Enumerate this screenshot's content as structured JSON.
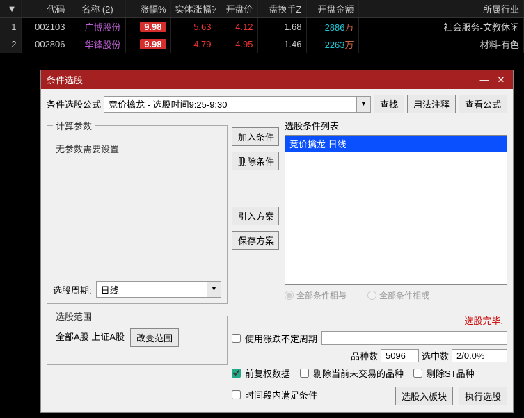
{
  "table": {
    "headers": [
      "代码",
      "名称 (2)",
      "涨幅%",
      "实体涨幅%",
      "开盘价",
      "盘换手Z",
      "开盘金额",
      "所属行业"
    ],
    "rows": [
      {
        "idx": "1",
        "code": "002103",
        "name": "广博股份",
        "pct": "9.98",
        "body": "5.63",
        "open": "4.12",
        "turn": "1.68",
        "amt_val": "2886",
        "amt_unit": "万",
        "industry": "社会服务-文教休闲"
      },
      {
        "idx": "2",
        "code": "002806",
        "name": "华锋股份",
        "pct": "9.98",
        "body": "4.79",
        "open": "4.95",
        "turn": "1.46",
        "amt_val": "2263",
        "amt_unit": "万",
        "industry": "材料-有色"
      }
    ]
  },
  "dialog": {
    "title": "条件选股",
    "formula_label": "条件选股公式",
    "formula_value": "竞价擒龙   - 选股时间9:25-9:30",
    "btn_search": "查找",
    "btn_usage": "用法注释",
    "btn_view_src": "查看公式",
    "params": {
      "legend": "计算参数",
      "none": "无参数需要设置",
      "period_label": "选股周期:",
      "period_value": "日线"
    },
    "mid_btns": {
      "add": "加入条件",
      "del": "删除条件",
      "import": "引入方案",
      "save": "保存方案"
    },
    "cond_list": {
      "legend": "选股条件列表",
      "items": [
        "竞价擒龙  日线"
      ],
      "radio_and": "全部条件相与",
      "radio_or": "全部条件相或"
    },
    "range": {
      "legend": "选股范围",
      "text": "全部A股 上证A股",
      "btn_change": "改变范围"
    },
    "status": "选股完毕.",
    "opts": {
      "use_period": "使用涨跌不定周期",
      "product_count_label": "品种数",
      "product_count": "5096",
      "hit_label": "选中数",
      "hit": "2/0.0%",
      "fuquan": "前复权数据",
      "remove_nontrade": "剔除当前未交易的品种",
      "remove_st": "剔除ST品种",
      "time_full": "时间段内满足条件"
    },
    "btn_to_block": "选股入板块",
    "btn_run": "执行选股"
  }
}
